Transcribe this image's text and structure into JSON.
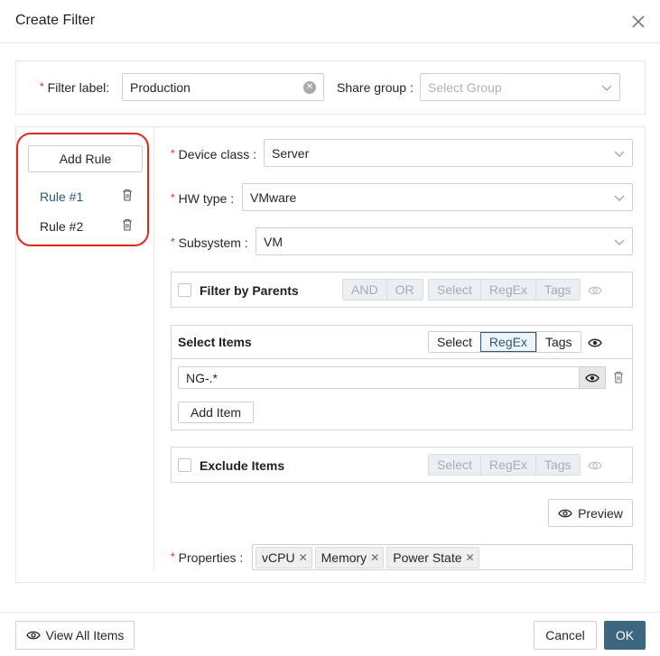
{
  "dialog": {
    "title": "Create Filter"
  },
  "filter": {
    "label_text": "Filter label",
    "label_value": "Production",
    "share_text": "Share group",
    "share_placeholder": "Select Group"
  },
  "rules": {
    "add_label": "Add Rule",
    "items": [
      {
        "label": "Rule #1",
        "active": true
      },
      {
        "label": "Rule #2",
        "active": false
      }
    ]
  },
  "fields": {
    "device_class": {
      "label": "Device class",
      "value": "Server"
    },
    "hw_type": {
      "label": "HW type",
      "value": "VMware"
    },
    "subsystem": {
      "label": "Subsystem",
      "value": "VM"
    }
  },
  "filter_by_parents": {
    "title": "Filter by Parents",
    "logic": [
      "AND",
      "OR"
    ],
    "modes": [
      "Select",
      "RegEx",
      "Tags"
    ]
  },
  "select_items": {
    "title": "Select Items",
    "modes": [
      "Select",
      "RegEx",
      "Tags"
    ],
    "active_mode": "RegEx",
    "regex_value": "NG-.*",
    "add_item_label": "Add Item"
  },
  "exclude_items": {
    "title": "Exclude Items",
    "modes": [
      "Select",
      "RegEx",
      "Tags"
    ]
  },
  "preview_label": "Preview",
  "properties": {
    "label": "Properties",
    "tags": [
      "vCPU",
      "Memory",
      "Power State"
    ]
  },
  "footer": {
    "view_all_label": "View All Items",
    "cancel_label": "Cancel",
    "ok_label": "OK"
  },
  "colors": {
    "required": "#e0281e",
    "accent": "#2c5a78",
    "primary_button": "#3d6680",
    "rules_outline": "#e0281e"
  },
  "icons": [
    "close-icon",
    "clear-icon",
    "chevron-down-icon",
    "trash-icon",
    "eye-icon",
    "remove-tag-icon"
  ]
}
